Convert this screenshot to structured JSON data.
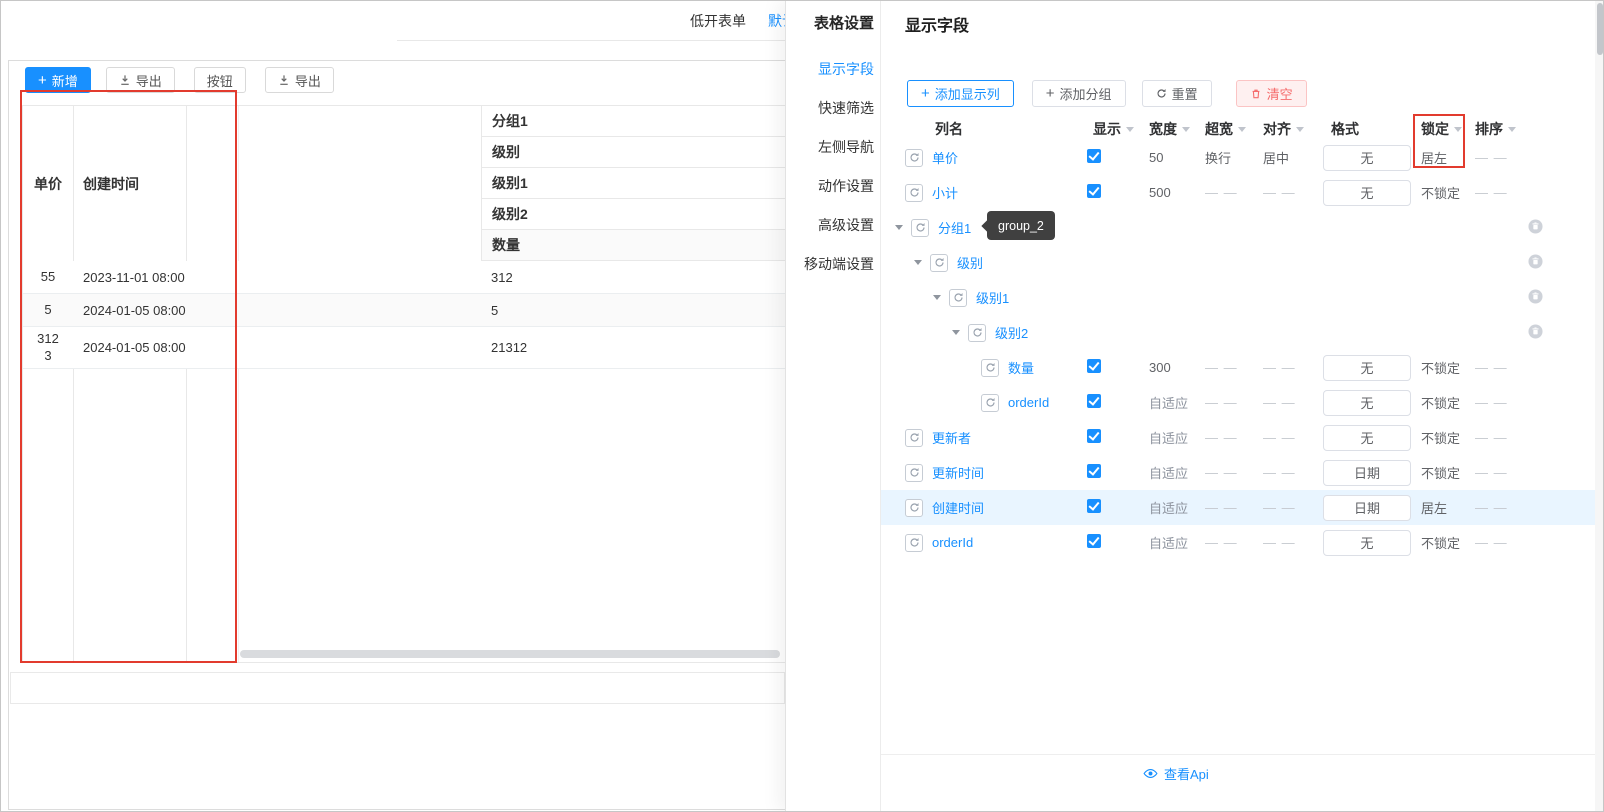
{
  "colors": {
    "accent": "#1890ff",
    "annotation": "#e23b2e",
    "danger": "#f56c6c",
    "row_highlight": "#e9f5ff"
  },
  "tabs": {
    "items": [
      {
        "label": "低开表单",
        "active": false
      },
      {
        "label": "默认",
        "active": true
      }
    ]
  },
  "toolbar": {
    "buttons": [
      {
        "label": "新增",
        "icon": "plus-icon",
        "primary": true
      },
      {
        "label": "导出",
        "icon": "download-icon",
        "primary": false
      },
      {
        "label": "按钮",
        "primary": false
      },
      {
        "label": "导出",
        "icon": "download-icon",
        "primary": false
      }
    ]
  },
  "data_table": {
    "fixed_columns": [
      "单价",
      "创建时间"
    ],
    "group_headers": [
      "分组1",
      "级别",
      "级别1",
      "级别2",
      "数量"
    ],
    "rows": [
      {
        "price": "55",
        "created": "2023-11-01 08:00",
        "qty": "312"
      },
      {
        "price": "5",
        "created": "2024-01-05 08:00",
        "qty": "5"
      },
      {
        "price": "3123",
        "created": "2024-01-05 08:00",
        "qty": "21312"
      }
    ]
  },
  "drawer": {
    "sidebar": {
      "title": "表格设置",
      "items": [
        "显示字段",
        "快速筛选",
        "左侧导航",
        "动作设置",
        "高级设置",
        "移动端设置"
      ],
      "active_index": 0
    },
    "panel_title": "显示字段",
    "actions": [
      {
        "label": "添加显示列",
        "icon": "plus-icon",
        "style": "primary-outline"
      },
      {
        "label": "添加分组",
        "icon": "plus-icon",
        "style": "default"
      },
      {
        "label": "重置",
        "icon": "refresh-icon",
        "style": "default"
      },
      {
        "label": "清空",
        "icon": "trash-icon",
        "style": "danger"
      }
    ],
    "fields_table": {
      "headers": [
        {
          "label": "列名",
          "sortable": false
        },
        {
          "label": "显示",
          "sortable": true
        },
        {
          "label": "宽度",
          "sortable": true
        },
        {
          "label": "超宽",
          "sortable": true
        },
        {
          "label": "对齐",
          "sortable": true
        },
        {
          "label": "格式",
          "sortable": false
        },
        {
          "label": "锁定",
          "sortable": true,
          "annotated": true
        },
        {
          "label": "排序",
          "sortable": true
        }
      ],
      "rows": [
        {
          "name": "单价",
          "indent": 0,
          "type": "field",
          "checked": true,
          "width": "50",
          "overflow": "换行",
          "align": "居中",
          "format": "无",
          "lock": "居左",
          "sort": "— —",
          "lock_annotated": true
        },
        {
          "name": "小计",
          "indent": 0,
          "type": "field",
          "checked": true,
          "width": "500",
          "overflow": "— —",
          "align": "— —",
          "format": "无",
          "lock": "不锁定",
          "sort": "— —"
        },
        {
          "name": "分组1",
          "indent": 0,
          "type": "group",
          "expanded": true,
          "tooltip": "group_2"
        },
        {
          "name": "级别",
          "indent": 1,
          "type": "group",
          "expanded": true
        },
        {
          "name": "级别1",
          "indent": 2,
          "type": "group",
          "expanded": true
        },
        {
          "name": "级别2",
          "indent": 3,
          "type": "group",
          "expanded": true
        },
        {
          "name": "数量",
          "indent": 4,
          "type": "field",
          "checked": true,
          "width": "300",
          "overflow": "— —",
          "align": "— —",
          "format": "无",
          "lock": "不锁定",
          "sort": "— —"
        },
        {
          "name": "orderId",
          "indent": 4,
          "type": "field",
          "checked": true,
          "width": "自适应",
          "overflow": "— —",
          "align": "— —",
          "format": "无",
          "lock": "不锁定",
          "sort": "— —"
        },
        {
          "name": "更新者",
          "indent": 0,
          "type": "field",
          "checked": true,
          "width": "自适应",
          "overflow": "— —",
          "align": "— —",
          "format": "无",
          "lock": "不锁定",
          "sort": "— —"
        },
        {
          "name": "更新时间",
          "indent": 0,
          "type": "field",
          "checked": true,
          "width": "自适应",
          "overflow": "— —",
          "align": "— —",
          "format": "日期",
          "lock": "不锁定",
          "sort": "— —"
        },
        {
          "name": "创建时间",
          "indent": 0,
          "type": "field",
          "checked": true,
          "width": "自适应",
          "overflow": "— —",
          "align": "— —",
          "format": "日期",
          "lock": "居左",
          "sort": "— —",
          "highlighted": true
        },
        {
          "name": "orderId",
          "indent": 0,
          "type": "field",
          "checked": true,
          "width": "自适应",
          "overflow": "— —",
          "align": "— —",
          "format": "无",
          "lock": "不锁定",
          "sort": "— —"
        }
      ]
    },
    "tooltip": {
      "text": "group_2"
    },
    "footer_link": {
      "label": "查看Api",
      "icon": "eye-icon"
    }
  }
}
